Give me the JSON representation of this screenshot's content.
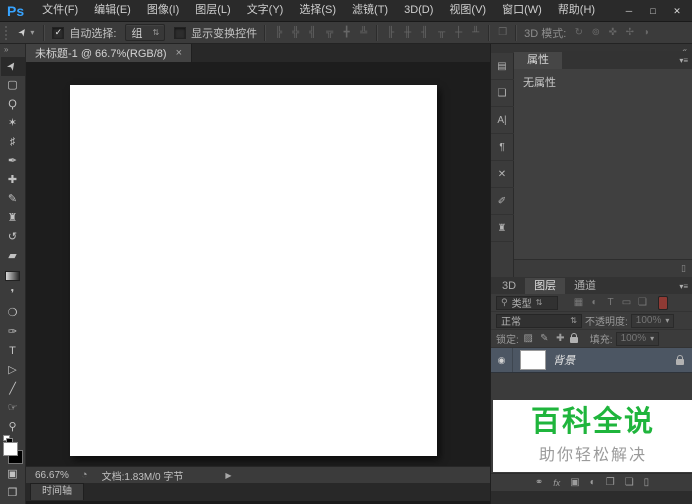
{
  "window": {
    "minimize": "─",
    "maximize": "□",
    "close": "✕"
  },
  "menubar": {
    "logo": "Ps",
    "items": [
      "文件(F)",
      "编辑(E)",
      "图像(I)",
      "图层(L)",
      "文字(Y)",
      "选择(S)",
      "滤镜(T)",
      "3D(D)",
      "视图(V)",
      "窗口(W)",
      "帮助(H)"
    ]
  },
  "optionsbar": {
    "tool_icon": "➤",
    "preset_arrow": "▾",
    "check_glyph": "✓",
    "auto_select_label": "自动选择:",
    "auto_select_value": "组",
    "dd_arrow": "⇅",
    "show_transform_label": "显示变换控件",
    "align_icons": [
      "╠",
      "╬",
      "╣",
      "╦",
      "╋",
      "╩"
    ],
    "distribute_icons": [
      "╟",
      "╫",
      "╢",
      "╥",
      "┼",
      "╨"
    ],
    "auto_align_icon": "❒",
    "mode_3d_label": "3D 模式:",
    "mode_3d_icons": [
      "↻",
      "⊚",
      "✜",
      "✢",
      "◗"
    ]
  },
  "document_tab": {
    "title": "未标题-1 @ 66.7%(RGB/8)",
    "close_glyph": "×"
  },
  "toolbar": {
    "collapse_glyph": "»",
    "tools": [
      {
        "name": "move",
        "glyph": "➤"
      },
      {
        "name": "rectangular-marquee",
        "glyph": "▢"
      },
      {
        "name": "lasso",
        "glyph": "Ϙ"
      },
      {
        "name": "magic-wand",
        "glyph": "✶"
      },
      {
        "name": "crop",
        "glyph": "♯"
      },
      {
        "name": "eyedropper",
        "glyph": "✒"
      },
      {
        "name": "spot-healing-brush",
        "glyph": "✚"
      },
      {
        "name": "brush",
        "glyph": "✎"
      },
      {
        "name": "clone-stamp",
        "glyph": "♜"
      },
      {
        "name": "history-brush",
        "glyph": "↺"
      },
      {
        "name": "eraser",
        "glyph": "▰"
      },
      {
        "name": "gradient",
        "glyph": ""
      },
      {
        "name": "blur",
        "glyph": "❜"
      },
      {
        "name": "dodge",
        "glyph": "❍"
      },
      {
        "name": "pen",
        "glyph": "✑"
      },
      {
        "name": "type",
        "glyph": "T"
      },
      {
        "name": "path-selection",
        "glyph": "▷"
      },
      {
        "name": "line",
        "glyph": "╱"
      },
      {
        "name": "hand",
        "glyph": "☞"
      },
      {
        "name": "zoom",
        "glyph": "⚲"
      }
    ],
    "foreground_color": "#ffffff",
    "background_color": "#000000",
    "quick_mask_glyph": "▣",
    "screen_mode_glyph": "❐"
  },
  "dock": {
    "collapse_glyph": "«",
    "menu_glyph": "▾≡",
    "strip_icons": [
      {
        "name": "history",
        "glyph": "▤"
      },
      {
        "name": "layer-comps",
        "glyph": "❑"
      },
      {
        "name": "character",
        "glyph": "A|"
      },
      {
        "name": "paragraph",
        "glyph": "¶"
      },
      {
        "name": "tool-presets",
        "glyph": "✕"
      },
      {
        "name": "brush",
        "glyph": "✐"
      },
      {
        "name": "clone-source",
        "glyph": "♜"
      }
    ],
    "properties": {
      "tab": "属性",
      "empty_text": "无属性",
      "trash_glyph": "▯"
    },
    "layers": {
      "tabs": [
        "3D",
        "图层",
        "通道"
      ],
      "filter": {
        "search_glyph": "⚲",
        "label": "类型",
        "arrow": "⇅",
        "icons": [
          "▦",
          "◐",
          "T",
          "▭",
          "❏"
        ]
      },
      "blend": {
        "value": "正常",
        "arrow": "⇅",
        "opacity_label": "不透明度:",
        "opacity_value": "100%",
        "value_arrow": "▾"
      },
      "lock": {
        "label": "锁定:",
        "icons": [
          "▨",
          "✎",
          "✚"
        ],
        "fill_label": "填充:",
        "fill_value": "100%"
      },
      "layer": {
        "eye_glyph": "◉",
        "name": "背景"
      },
      "bottom_icons": [
        {
          "name": "link-layers",
          "glyph": "⚭"
        },
        {
          "name": "layer-style",
          "glyph": "fx"
        },
        {
          "name": "layer-mask",
          "glyph": "▣"
        },
        {
          "name": "adjustment-layer",
          "glyph": "◐"
        },
        {
          "name": "new-group",
          "glyph": "❐"
        },
        {
          "name": "new-layer",
          "glyph": "❏"
        },
        {
          "name": "delete-layer",
          "glyph": "▯"
        }
      ]
    }
  },
  "watermark": {
    "title": "百科全说",
    "subtitle": "助你轻松解决",
    "title_color": "#1fb53c"
  },
  "statusbar": {
    "zoom": "66.67%",
    "clock_glyph": "◔",
    "doc_info": "文档:1.83M/0 字节",
    "arrow_glyph": "▶"
  },
  "timeline": {
    "tab": "时间轴"
  },
  "colors": {
    "ps_logo_blue": "#37a3ff",
    "watermark_green": "#1fb53c",
    "selected_layer_row": "#4c5663",
    "filter_toggle_red": "#8f3a34"
  }
}
